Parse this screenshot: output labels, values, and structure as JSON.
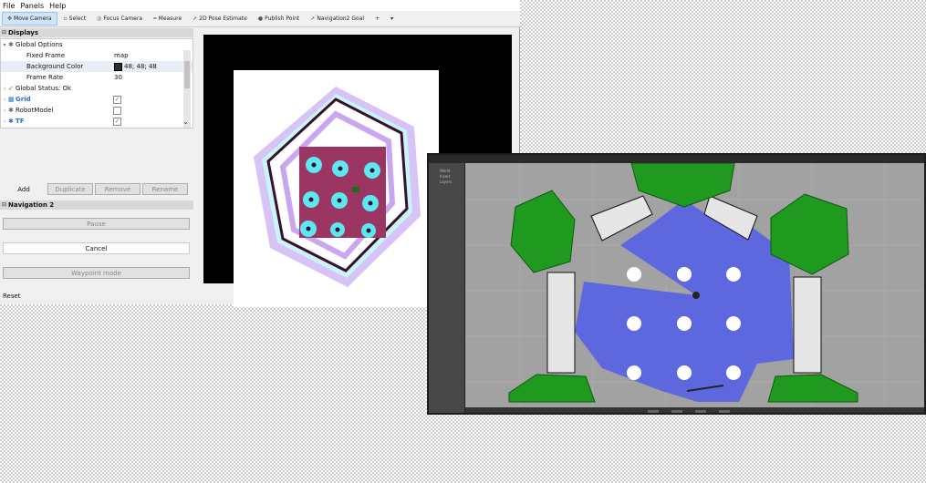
{
  "menu": [
    "File",
    "Panels",
    "Help"
  ],
  "toolbar": [
    {
      "label": "Move Camera",
      "icon": "move-icon",
      "active": true
    },
    {
      "label": "Select",
      "icon": "select-icon",
      "active": false
    },
    {
      "label": "Focus Camera",
      "icon": "focus-icon",
      "active": false
    },
    {
      "label": "Measure",
      "icon": "measure-icon",
      "active": false
    },
    {
      "label": "2D Pose Estimate",
      "icon": "pose-icon",
      "active": false
    },
    {
      "label": "Publish Point",
      "icon": "publish-icon",
      "active": false
    },
    {
      "label": "Navigation2 Goal",
      "icon": "goal-icon",
      "active": false
    }
  ],
  "toolbar_extra": {
    "plus": "+",
    "more": "▾"
  },
  "displays": {
    "title": "Displays",
    "global_options": "Global Options",
    "fixed_frame_label": "Fixed Frame",
    "fixed_frame_value": "map",
    "background_color_label": "Background Color",
    "background_color_value": "48; 48; 48",
    "background_color_hex": "#303030",
    "frame_rate_label": "Frame Rate",
    "frame_rate_value": "30",
    "global_status": "Global Status: Ok",
    "grid": "Grid",
    "robot_model": "RobotModel",
    "tf": "TF"
  },
  "buttons": {
    "add": "Add",
    "duplicate": "Duplicate",
    "remove": "Remove",
    "rename": "Rename"
  },
  "navigation": {
    "title": "Navigation 2",
    "pause": "Pause",
    "cancel": "Cancel",
    "waypoint": "Waypoint mode"
  },
  "reset": "Reset",
  "colors": {
    "costmap_purple": "#c9a7f0",
    "costmap_cyan": "#5ce8f0",
    "costmap_core": "#9b3562",
    "obstacle": "#3a0f2a",
    "laser_blue": "#5561e4",
    "pillar_green": "#1f9a1f",
    "floor_gray": "#a2a2a2"
  },
  "gazebo": {
    "menu_items": [
      "World",
      "Insert",
      "Layers"
    ]
  }
}
